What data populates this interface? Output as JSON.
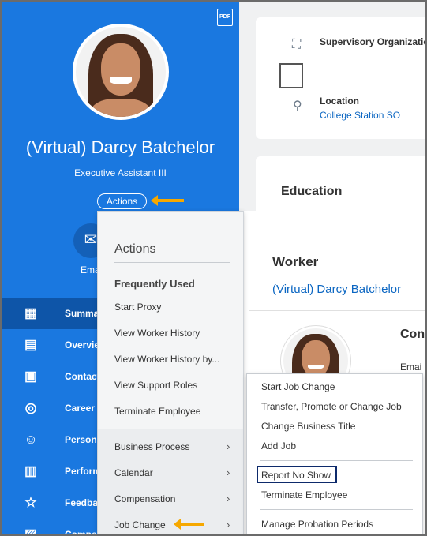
{
  "profile": {
    "pdf_label": "PDF",
    "name": "(Virtual) Darcy Batchelor",
    "job_title": "Executive Assistant III",
    "actions_label": "Actions",
    "email_label": "Email"
  },
  "nav": {
    "items": [
      {
        "label": "Summary",
        "icon": "grid-icon"
      },
      {
        "label": "Overview",
        "icon": "document-icon"
      },
      {
        "label": "Contact",
        "icon": "contact-card-icon"
      },
      {
        "label": "Career",
        "icon": "target-icon"
      },
      {
        "label": "Personal",
        "icon": "person-icon"
      },
      {
        "label": "Performance",
        "icon": "clipboard-icon"
      },
      {
        "label": "Feedback",
        "icon": "star-icon"
      },
      {
        "label": "Compensation",
        "icon": "chart-icon"
      }
    ]
  },
  "org_card": {
    "supervisory_label": "Supervisory Organization",
    "location_label": "Location",
    "location_value": "College Station SO"
  },
  "education": {
    "title": "Education"
  },
  "worker": {
    "title": "Worker",
    "name": "(Virtual) Darcy Batchelor",
    "contact_heading": "Con",
    "email_label": "Emai"
  },
  "actions_menu": {
    "heading": "Actions",
    "section": "Frequently Used",
    "frequent": [
      "Start Proxy",
      "View Worker History",
      "View Worker History by...",
      "View Support Roles",
      "Terminate Employee"
    ],
    "categories": [
      "Business Process",
      "Calendar",
      "Compensation",
      "Job Change"
    ]
  },
  "job_change_menu": {
    "items": [
      "Start Job Change",
      "Transfer, Promote or Change Job",
      "Change Business Title",
      "Add Job",
      "Report No Show",
      "Terminate Employee",
      "Manage Probation Periods"
    ],
    "highlighted": "Report No Show"
  },
  "colors": {
    "profile_bg": "#1a78e0",
    "nav_active": "#0e55a8",
    "arrow": "#f6a800",
    "link": "#0b66c2",
    "highlight_border": "#0d2a6b"
  }
}
